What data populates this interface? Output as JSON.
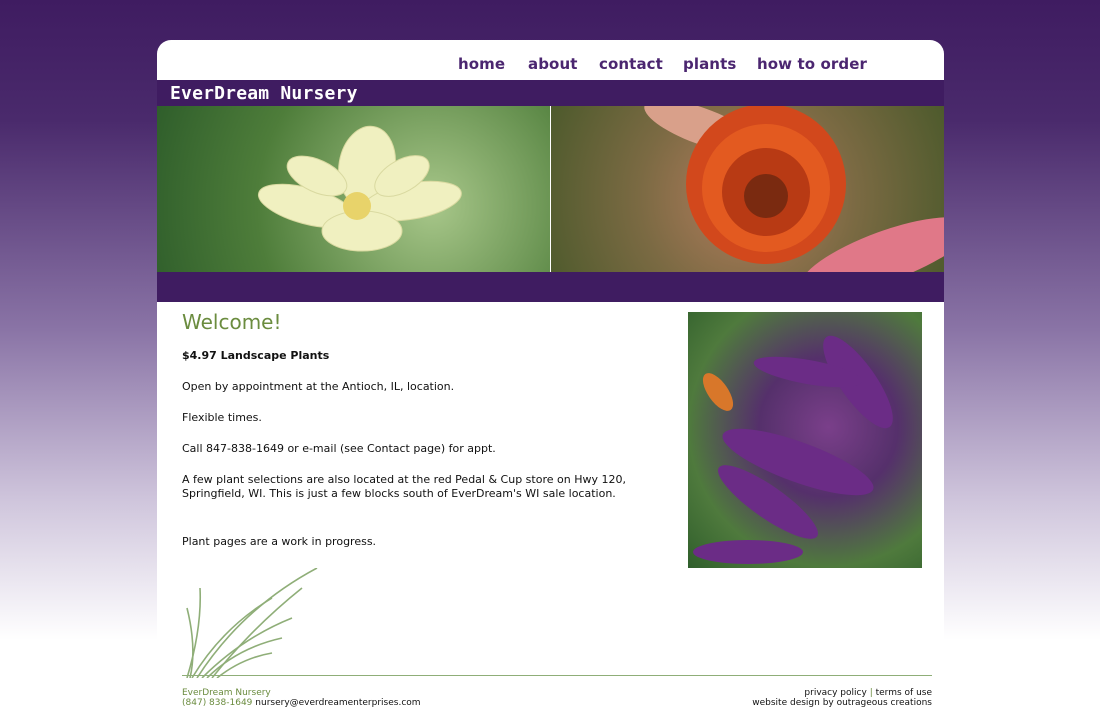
{
  "nav": {
    "home": "home",
    "about": "about",
    "contact": "contact",
    "plants": "plants",
    "how_to_order": "how to order"
  },
  "brand": {
    "name": "EverDream Nursery"
  },
  "content": {
    "heading": "Welcome!",
    "price_line": "$4.97 Landscape Plants",
    "open_line": "Open by appointment at the Antioch, IL, location.",
    "flex_line": "Flexible times.",
    "call_line": "Call 847-838-1649 or e-mail (see Contact page) for appt.",
    "store_line_1": "A few plant selections are also located at the red Pedal & Cup store on Hwy 120,",
    "store_line_2": "Springfield, WI. This is just a few blocks south of EverDream's WI sale location.",
    "plant_pages": "Plant pages are a work in progress."
  },
  "footer": {
    "company": "EverDream Nursery",
    "phone": "(847) 838-1649",
    "email": "nursery@everdreamenterprises.com",
    "privacy": "privacy policy",
    "separator": "|",
    "terms": "terms of use",
    "credit": "website design by outrageous creations"
  },
  "colors": {
    "purple": "#3f1c61",
    "nav_text": "#4b2670",
    "green": "#6b8c3f"
  }
}
